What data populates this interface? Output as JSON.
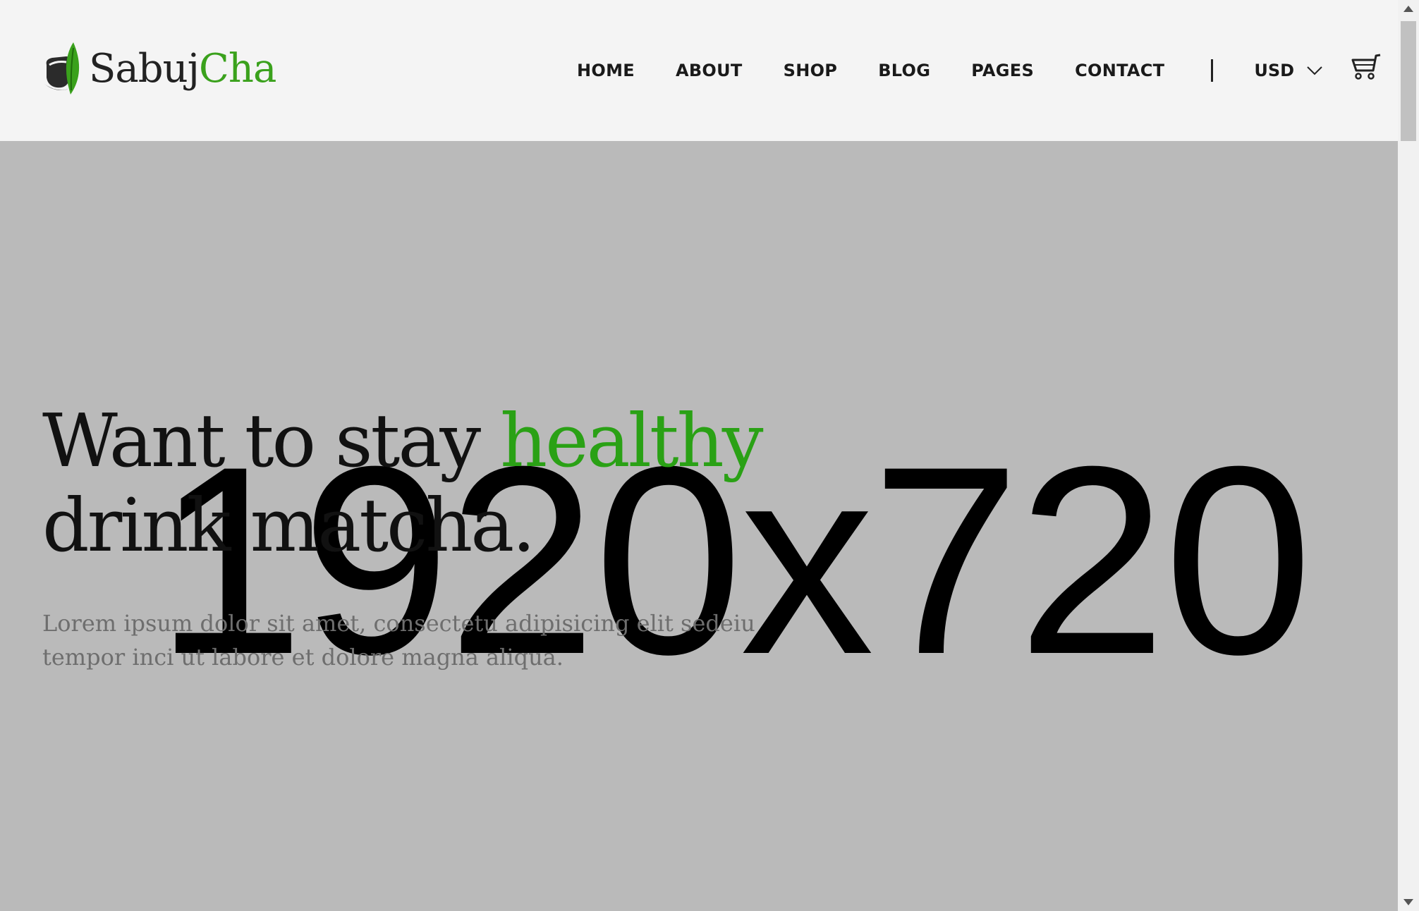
{
  "brand": {
    "name_part1": "Sabuj",
    "name_part2": "Cha",
    "icon": "tea-cup-leaf-logo",
    "accent_color": "#3aa11c"
  },
  "nav": {
    "items": [
      {
        "label": "HOME"
      },
      {
        "label": "ABOUT"
      },
      {
        "label": "SHOP"
      },
      {
        "label": "BLOG"
      },
      {
        "label": "PAGES"
      },
      {
        "label": "CONTACT"
      }
    ],
    "currency": "USD",
    "currency_icon": "chevron-down-icon",
    "cart_icon": "shopping-cart-icon"
  },
  "hero": {
    "placeholder_text": "1920x720",
    "headline_part1": "Want to stay ",
    "headline_accent": "healthy",
    "headline_part2": "drink matcha.",
    "subtext": "Lorem ipsum dolor sit amet, consectetu adipisicing elit sedeiu tempor inci ut labore et dolore magna aliqua.",
    "background_color": "#bababa"
  }
}
